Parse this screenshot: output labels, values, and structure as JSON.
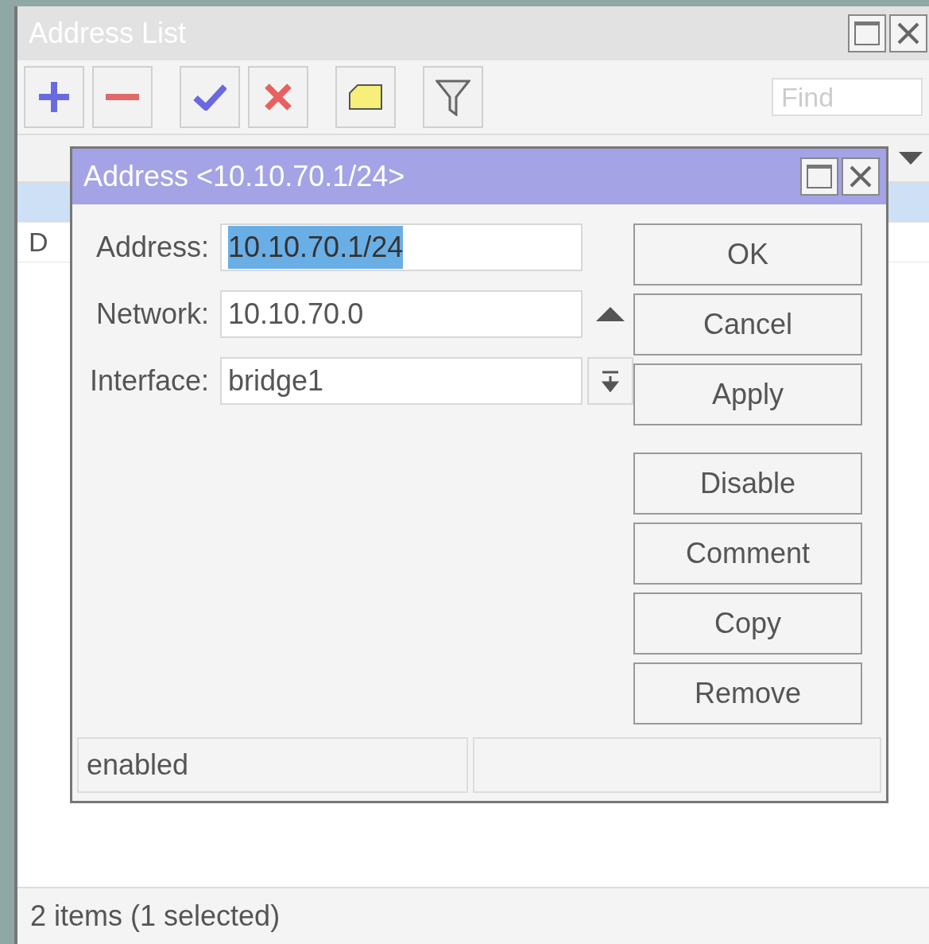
{
  "window": {
    "title": "Address List"
  },
  "find": {
    "placeholder": "Find"
  },
  "table": {
    "rows": [
      {
        "selected": true
      },
      {
        "column_1": "D",
        "selected": false
      }
    ]
  },
  "status_bar": "2 items (1 selected)",
  "dialog": {
    "title": "Address <10.10.70.1/24>",
    "fields": [
      {
        "label": "Address:",
        "value": "10.10.70.1/24",
        "kind": "text",
        "value_selected": true
      },
      {
        "label": "Network:",
        "value": "10.10.70.0",
        "kind": "collapse",
        "value_selected": false
      },
      {
        "label": "Interface:",
        "value": "bridge1",
        "kind": "dropdown",
        "value_selected": false
      }
    ],
    "button_groups": [
      [
        {
          "label": "OK"
        },
        {
          "label": "Cancel"
        },
        {
          "label": "Apply"
        }
      ],
      [
        {
          "label": "Disable"
        },
        {
          "label": "Comment"
        },
        {
          "label": "Copy"
        },
        {
          "label": "Remove"
        }
      ]
    ],
    "status": [
      "enabled"
    ]
  }
}
